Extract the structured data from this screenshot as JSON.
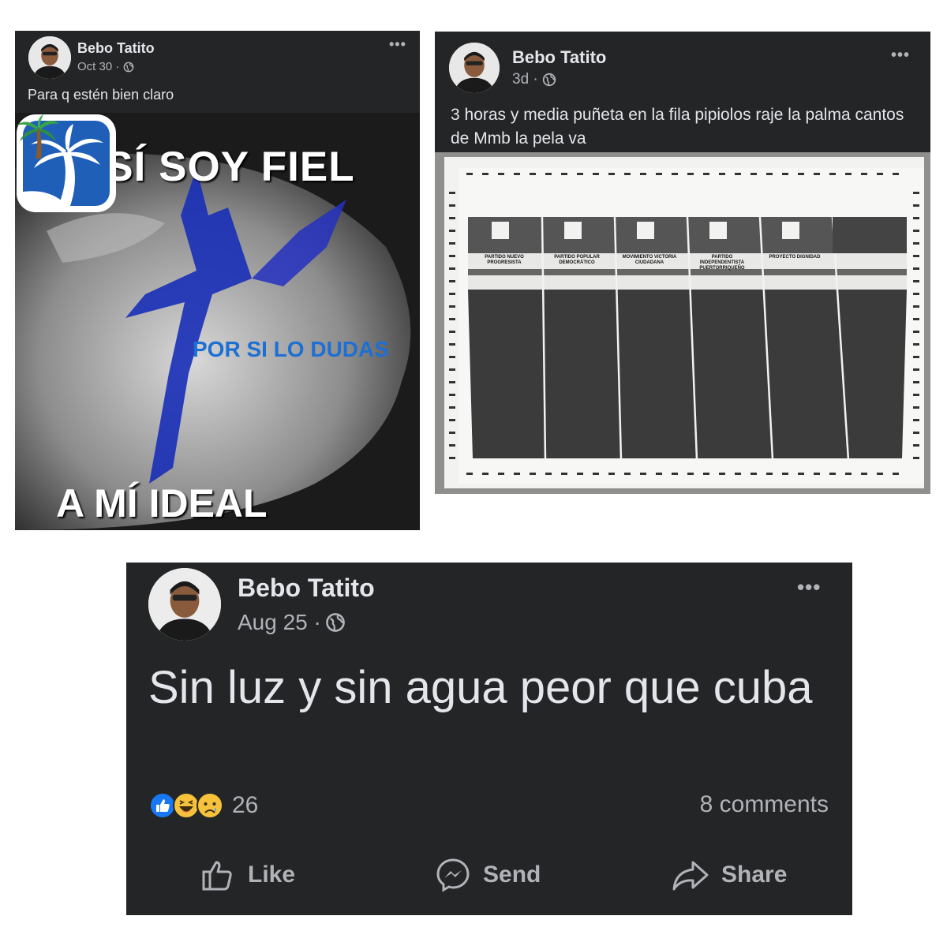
{
  "posts": [
    {
      "author": "Bebo Tatito",
      "time": "Oct 30 ·",
      "caption": "Para q estén bien claro",
      "image": {
        "text_top": "YO SÍ SOY FIEL",
        "text_middle": "POR SI LO DUDAS",
        "text_bottom": "A MÍ IDEAL",
        "logo_icon": "palm-tree-logo-icon",
        "emoji_icon": "palm-tree-emoji-icon"
      }
    },
    {
      "author": "Bebo Tatito",
      "time": "3d ·",
      "caption": "3 horas y media puñeta en la fila pipiolos raje la palma cantos de Mmb la pela va",
      "image": {
        "ballot_parties": [
          "PARTIDO NUEVO PROGRESISTA",
          "PARTIDO POPULAR DEMOCRÁTICO",
          "MOVIMIENTO VICTORIA CIUDADANA",
          "PARTIDO INDEPENDENTISTA PUERTORRIQUEÑO",
          "PROYECTO DIGNIDAD"
        ]
      }
    },
    {
      "author": "Bebo Tatito",
      "time": "Aug 25 ·",
      "caption": "Sin luz y sin agua peor que cuba",
      "reactions_count": "26",
      "comments": "8 comments",
      "actions": {
        "like": "Like",
        "send": "Send",
        "share": "Share"
      }
    }
  ],
  "icons": {
    "more": "more-options-icon",
    "privacy": "globe-icon",
    "reactions": [
      "like-reaction-icon",
      "haha-reaction-icon",
      "sad-reaction-icon"
    ]
  },
  "colors": {
    "post_bg": "#242526",
    "text_primary": "#e4e6eb",
    "text_secondary": "#b0b3b8",
    "like_blue": "#1877f2",
    "party_blue": "#1e6fd3"
  }
}
